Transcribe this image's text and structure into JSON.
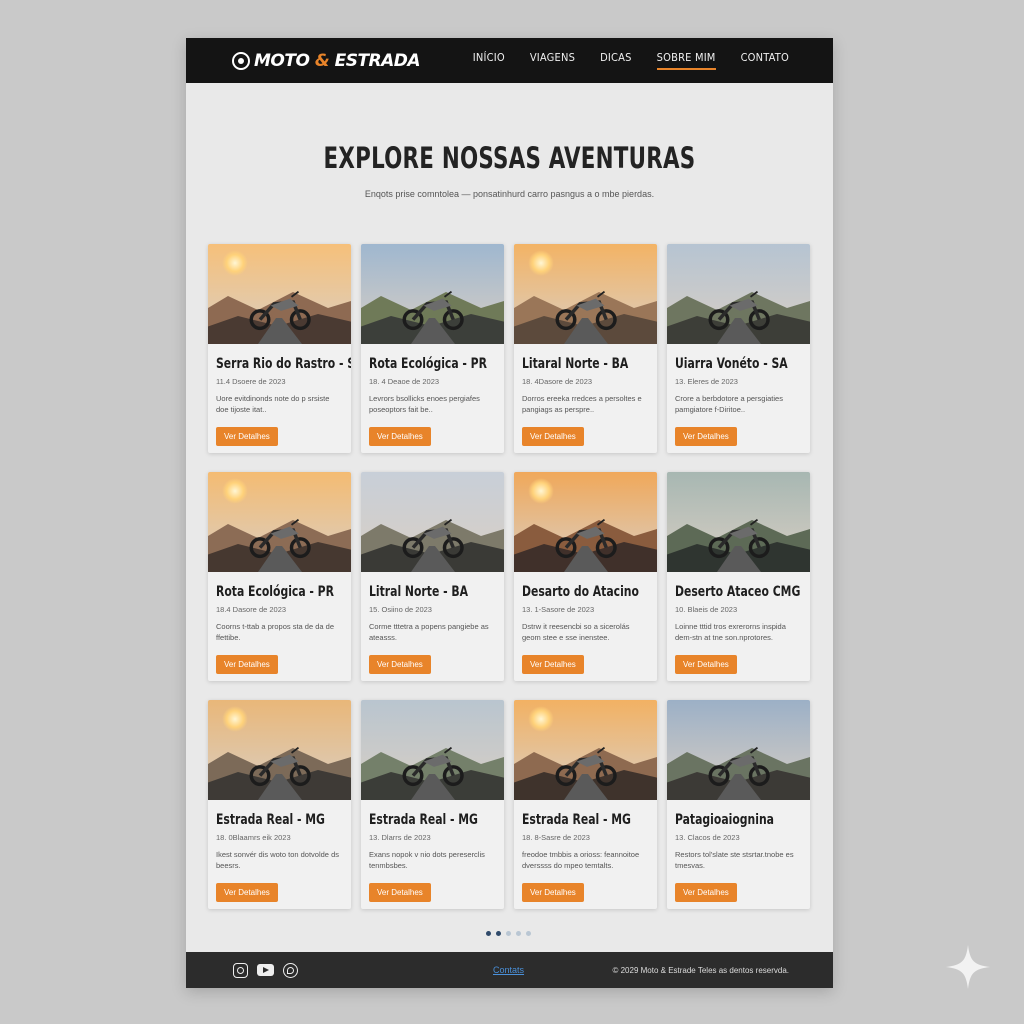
{
  "brand": {
    "name_part1": "MOTO",
    "amp": "&",
    "name_part2": "ESTRADA"
  },
  "nav": [
    {
      "label": "INÍCIO",
      "active": false
    },
    {
      "label": "VIAGENS",
      "active": false
    },
    {
      "label": "DICAS",
      "active": false
    },
    {
      "label": "SOBRE MIM",
      "active": true
    },
    {
      "label": "CONTATO",
      "active": false
    }
  ],
  "hero": {
    "title": "EXPLORE NOSSAS AVENTURAS",
    "subtitle": "Enqots prise comntolea — ponsatinhurd carro pasngus a o mbe pierdas."
  },
  "button_label": "Ver Detalhes",
  "cards": [
    {
      "title": "Serra Rio do Rastro - SC",
      "date": "11.4 Dsoere de 2023",
      "text": "Uore evitdinonds note do p srsiste doe tijoste itat.."
    },
    {
      "title": "Rota Ecológica - PR",
      "date": "18. 4 Deaoe de 2023",
      "text": "Levrors bsollicks enoes pergiafes poseoptors fait be.."
    },
    {
      "title": "Litaral Norte - BA",
      "date": "18. 4Dasore de 2023",
      "text": "Dorros ereeka rredces a persoltes e pangiags as perspre.."
    },
    {
      "title": "Uiarra Vonéto - SA",
      "date": "13. Eleres de 2023",
      "text": "Crore a berbdotore a persgiaties pamgiatore f-Diritoe.."
    },
    {
      "title": "Rota Ecológica - PR",
      "date": "18.4 Dasore de 2023",
      "text": "Coorns t-ttab a propos sta de da de ffettibe."
    },
    {
      "title": "Litral Norte - BA",
      "date": "15. Osiino de 2023",
      "text": "Corme tttetra a popens pangiebe as ateasss."
    },
    {
      "title": "Desarto do Atacino",
      "date": "13. 1-Sasore de 2023",
      "text": "Dstrw it reesencbi so a sicerolás geom stee e sse inenstee."
    },
    {
      "title": "Deserto Ataceo CMG",
      "date": "10. Blaeis de 2023",
      "text": "Loinne tttid tros exrerorns inspida dem-stn at tne son.nprotores."
    },
    {
      "title": "Estrada Real - MG",
      "date": "18. 0Blaamrs eik 2023",
      "text": "Ikest sonvér dis woto ton dotvolde ds beesrs."
    },
    {
      "title": "Estrada Real - MG",
      "date": "13. Dlarrs de 2023",
      "text": "Exans nopok v nio dots pereserclis tenmbsbes."
    },
    {
      "title": "Estrada Real - MG",
      "date": "18. 8-Sasre de 2023",
      "text": "freodoe tmbbis a orioss: feannoitoe dverssss do mpeo temtalts."
    },
    {
      "title": "Patagioaiognina",
      "date": "13. Clacos de 2023",
      "text": "Restors tol'slate ste stsrtar.tnobe es tmesvas."
    }
  ],
  "footer": {
    "contact_link": "Contats",
    "copyright": "© 2029 Moto & Estrade Teles as dentos reservda."
  },
  "colors": {
    "accent": "#e8842a",
    "nav_bg": "#141414",
    "footer_bg": "#2c2c2c",
    "link": "#4a90d9"
  }
}
